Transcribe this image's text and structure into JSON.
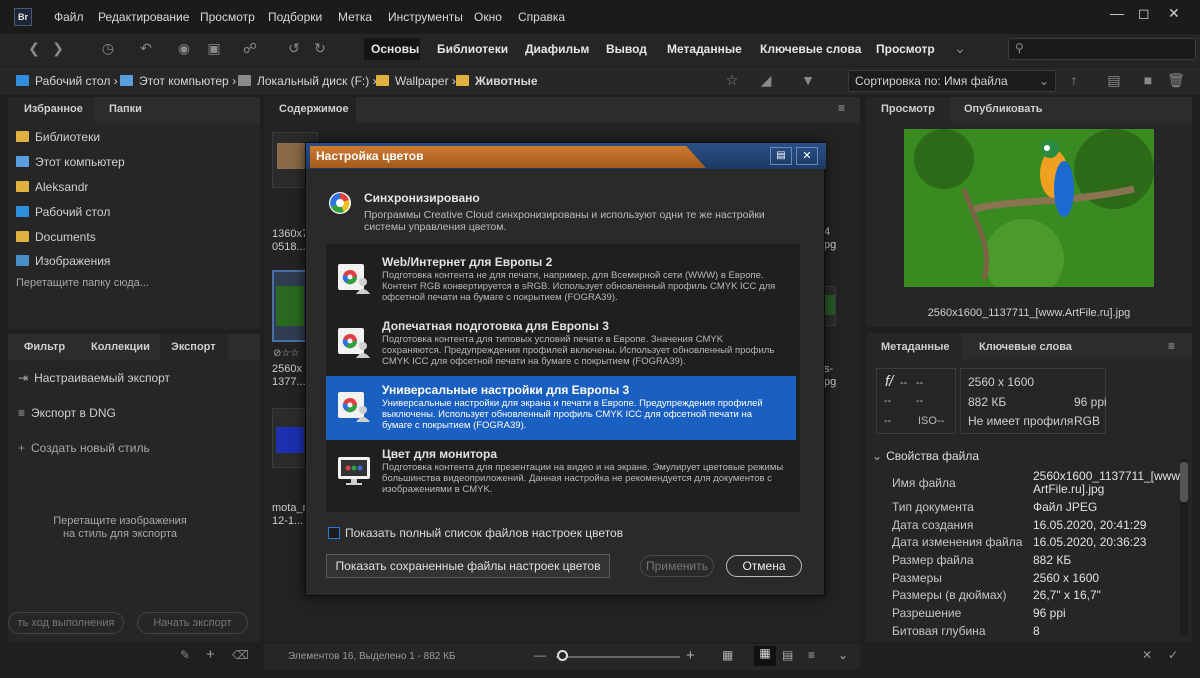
{
  "app_logo": "Br",
  "menu": [
    "Файл",
    "Редактирование",
    "Просмотр",
    "Подборки",
    "Метка",
    "Инструменты",
    "Окно",
    "Справка"
  ],
  "workspaces": [
    "Основы",
    "Библиотеки",
    "Диафильм",
    "Вывод",
    "Метаданные",
    "Ключевые слова",
    "Просмотр"
  ],
  "breadcrumb": [
    "Рабочий стол",
    "Этот компьютер",
    "Локальный диск (F:)",
    "Wallpaper",
    "Животные"
  ],
  "sort_label": "Сортировка по: Имя файла",
  "left_tabs": {
    "favorites": "Избранное",
    "folders": "Папки"
  },
  "favorites": [
    {
      "label": "Библиотеки",
      "icon": "folder-icon"
    },
    {
      "label": "Этот компьютер",
      "icon": "computer-icon"
    },
    {
      "label": "Aleksandr",
      "icon": "folder-icon"
    },
    {
      "label": "Рабочий стол",
      "icon": "desktop-icon"
    },
    {
      "label": "Documents",
      "icon": "folder-icon"
    },
    {
      "label": "Изображения",
      "icon": "images-icon"
    }
  ],
  "drag_folder_hint": "Перетащите папку сюда...",
  "lower_tabs": {
    "filter": "Фильтр",
    "collections": "Коллекции",
    "export": "Экспорт"
  },
  "export_items": [
    "Настраиваемый экспорт",
    "Экспорт в DNG",
    "Создать новый стиль"
  ],
  "export_hint": [
    "Перетащите изображения",
    "на стиль для экспорта"
  ],
  "export_buttons": {
    "progress": "ть ход выполнения",
    "start": "Начать экспорт"
  },
  "content_tab": "Содержимое",
  "thumbs": [
    {
      "line1": "1360x7",
      "line2": "0518..."
    },
    {
      "line1": "2560x",
      "line2": "1377..."
    },
    {
      "line1": "mota_r",
      "line2": "12-1..."
    }
  ],
  "thumb_right_labels": [
    "4",
    "pg",
    "s-",
    "pg"
  ],
  "status_text": "Элементов 16, Выделено 1 - 882 КБ",
  "right_tabs": {
    "preview": "Просмотр",
    "publish": "Опубликовать"
  },
  "preview_caption": "2560x1600_1137711_[www.ArtFile.ru].jpg",
  "meta_tabs": {
    "metadata": "Метаданные",
    "keywords": "Ключевые слова"
  },
  "meta_summary": {
    "aperture": "f/",
    "fdash": "--",
    "dash": "--",
    "iso": "ISO--",
    "dims": "2560 x 1600",
    "size": "882 КБ",
    "ppi": "96 ppi",
    "profile": "Не имеет профиля",
    "mode": "RGB"
  },
  "file_props_title": "Свойства файла",
  "file_props": [
    {
      "label": "Имя файла",
      "value": "2560x1600_1137711_[www.\nArtFile.ru].jpg"
    },
    {
      "label": "Тип документа",
      "value": "Файл JPEG"
    },
    {
      "label": "Дата создания",
      "value": "16.05.2020, 20:41:29"
    },
    {
      "label": "Дата изменения файла",
      "value": "16.05.2020, 20:36:23"
    },
    {
      "label": "Размер файла",
      "value": "882 КБ"
    },
    {
      "label": "Размеры",
      "value": "2560 x 1600"
    },
    {
      "label": "Размеры (в дюймах)",
      "value": "26,7\" x 16,7\""
    },
    {
      "label": "Разрешение",
      "value": "96 ppi"
    },
    {
      "label": "Битовая глубина",
      "value": "8"
    }
  ],
  "dialog": {
    "title": "Настройка цветов",
    "sync_title": "Синхронизировано",
    "sync_desc": "Программы Creative Cloud синхронизированы и используют одни те же настройки системы управления цветом.",
    "options": [
      {
        "title": "Web/Интернет для Европы 2",
        "desc": "Подготовка контента не для печати, например, для Всемирной сети (WWW) в Европе. Контент RGB конвертируется в sRGB. Использует обновленный профиль CMYK ICC для офсетной печати на бумаге с покрытием (FOGRA39).",
        "selected": false,
        "icon": "color-profile-icon"
      },
      {
        "title": "Допечатная подготовка для Европы 3",
        "desc": "Подготовка контента для типовых условий печати в Европе. Значения CMYK сохраняются. Предупреждения профилей включены. Использует обновленный профиль CMYK ICC для офсетной печати на бумаге с покрытием (FOGRA39).",
        "selected": false,
        "icon": "color-profile-icon"
      },
      {
        "title": "Универсальные настройки для Европы 3",
        "desc": "Универсальные настройки для экрана и печати в Европе. Предупреждения профилей выключены. Использует обновленный профиль CMYK ICC для офсетной печати на бумаге с покрытием (FOGRA39).",
        "selected": true,
        "icon": "color-profile-icon"
      },
      {
        "title": "Цвет для монитора",
        "desc": "Подготовка контента для презентации на видео и на экране. Эмулирует цветовые режимы большинства видеоприложений. Данная настройка не рекомендуется для документов с изображениями в CMYK.",
        "selected": false,
        "icon": "monitor-icon"
      }
    ],
    "checkbox_label": "Показать полный список файлов настроек цветов",
    "show_saved": "Показать сохраненные файлы настроек цветов",
    "apply": "Применить",
    "cancel": "Отмена"
  },
  "colors": {
    "accent": "#1a5fc2",
    "title_orange": "#c46e28",
    "title_blue": "#2a4f86"
  }
}
